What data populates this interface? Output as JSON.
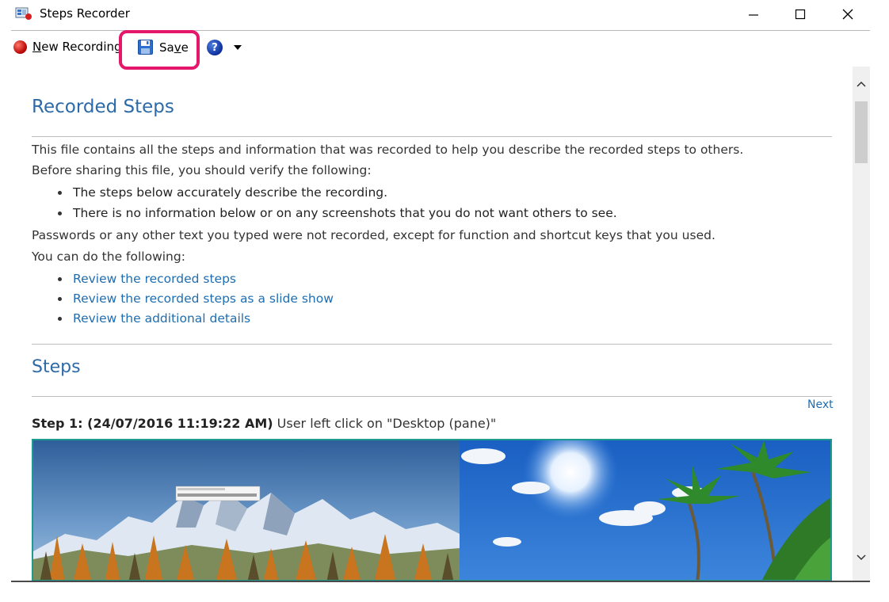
{
  "window": {
    "title": "Steps Recorder"
  },
  "toolbar": {
    "new_recording_pre": "N",
    "new_recording_rest": "ew Recording",
    "save_pre": "Sa",
    "save_accel": "v",
    "save_post": "e",
    "highlight_color": "#e5176a"
  },
  "doc": {
    "heading": "Recorded Steps",
    "intro1": "This file contains all the steps and information that was recorded to help you describe the recorded steps to others.",
    "intro2": "Before sharing this file, you should verify the following:",
    "verify": [
      "The steps below accurately describe the recording.",
      "There is no information below or on any screenshots that you do not want others to see."
    ],
    "passwords_note": "Passwords or any other text you typed were not recorded, except for function and shortcut keys that you used.",
    "can_do": "You can do the following:",
    "links": [
      "Review the recorded steps",
      "Review the recorded steps as a slide show",
      "Review the additional details"
    ],
    "steps_heading": "Steps",
    "next_label": "Next",
    "step1_prefix": "Step 1: (24/07/2016 11:19:22 AM)",
    "step1_text": " User left click on \"Desktop (pane)\""
  },
  "colors": {
    "heading": "#2d6aa8",
    "link": "#1f6db0",
    "shot_border": "#1f9a8e"
  }
}
